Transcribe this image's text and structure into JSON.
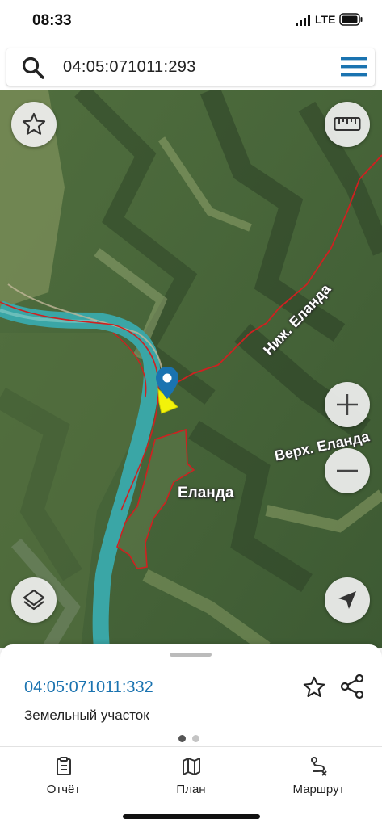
{
  "status_bar": {
    "time": "08:33",
    "network": "LTE"
  },
  "search": {
    "query": "04:05:071011:293"
  },
  "map": {
    "labels": {
      "river_1": "Ниж. Еланда",
      "river_2": "Верх. Еланда",
      "village": "Еланда"
    },
    "colors": {
      "boundary": "#d02020",
      "selected_parcel": "#f2f20a",
      "river": "#3aa6a6",
      "pin": "#1a73b0"
    }
  },
  "sheet": {
    "cadastral_number": "04:05:071011:332",
    "object_type": "Земельный участок",
    "page_dots": 2,
    "active_dot": 0
  },
  "tabs": [
    {
      "label": "Отчёт",
      "icon": "report-icon"
    },
    {
      "label": "План",
      "icon": "map-plan-icon"
    },
    {
      "label": "Маршрут",
      "icon": "route-icon"
    }
  ]
}
